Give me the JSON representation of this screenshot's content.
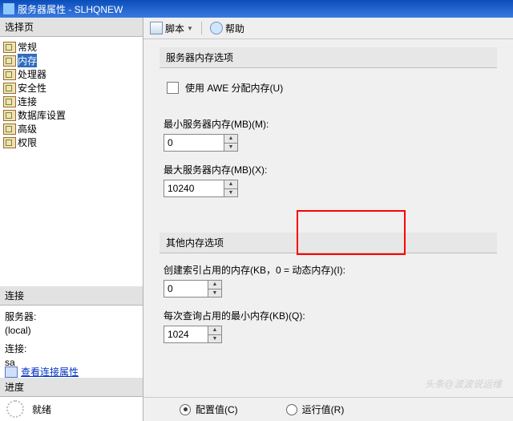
{
  "titlebar": "服务器属性 - SLHQNEW",
  "left": {
    "hdr_pages": "选择页",
    "items": [
      {
        "label": "常规"
      },
      {
        "label": "内存",
        "sel": true
      },
      {
        "label": "处理器"
      },
      {
        "label": "安全性"
      },
      {
        "label": "连接"
      },
      {
        "label": "数据库设置"
      },
      {
        "label": "高级"
      },
      {
        "label": "权限"
      }
    ],
    "hdr_conn": "连接",
    "conn": {
      "l1": "服务器:",
      "v1": "(local)",
      "l2": "连接:",
      "v2": "sa",
      "link": "查看连接属性"
    },
    "hdr_prog": "进度",
    "prog": "就绪"
  },
  "tb": {
    "script": "脚本",
    "help": "帮助"
  },
  "main": {
    "hdr1": "服务器内存选项",
    "awe": "使用 AWE 分配内存(U)",
    "l_min": "最小服务器内存(MB)(M):",
    "v_min": "0",
    "l_max": "最大服务器内存(MB)(X):",
    "v_max": "10240",
    "hdr2": "其他内存选项",
    "l_idx": "创建索引占用的内存(KB，0 = 动态内存)(I):",
    "v_idx": "0",
    "l_qry": "每次查询占用的最小内存(KB)(Q):",
    "v_qry": "1024"
  },
  "foot": {
    "cfg": "配置值(C)",
    "run": "运行值(R)"
  },
  "wm": "头条@波波说运维"
}
